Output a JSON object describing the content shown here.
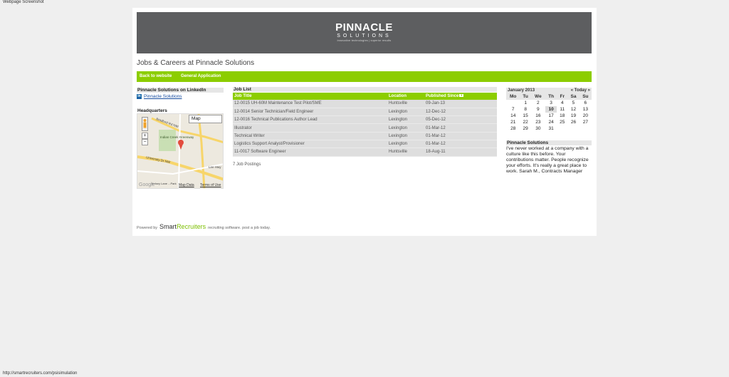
{
  "caption": "Webpage Screenshot",
  "status_url": "http://smartrecruiters.com/psisimulation",
  "banner": {
    "logo_main": "PINNACLE",
    "logo_sub": "SOLUTIONS",
    "logo_tag": "innovative technologies | superior results",
    "bg_color": "#5d5e60"
  },
  "page_title": "Jobs & Careers at Pinnacle Solutions",
  "nav": {
    "back_label": "Back to website",
    "general_label": "General Application",
    "accent_color": "#8ccd00"
  },
  "sidebar": {
    "linkedin_title": "Pinnacle Solutions on LinkedIn",
    "linkedin_link": "Pinnacle Solutions",
    "linkedin_icon": "in",
    "hq_title": "Headquarters",
    "map": {
      "type_select": "Map",
      "zoom_in": "+",
      "zoom_out": "−",
      "label_park": "Indian Creek Greenway",
      "label_road1": "University Dr NW",
      "label_road2": "Lee Hwy",
      "label_road3": "Bradford Rd NW",
      "label_bottom": "Kelsey Lane ...Park",
      "google": "Google",
      "map_data": "Map Data",
      "terms": "Terms of Use"
    }
  },
  "jobs": {
    "section_title": "Job List",
    "columns": [
      "Job Title",
      "Location",
      "Published Since"
    ],
    "rows": [
      {
        "title": "12-0015 UH-60M Maintenance Test Pilot/SME",
        "location": "Huntsville",
        "date": "09-Jan-13"
      },
      {
        "title": "12-0014 Senior Technician/Field Engineer",
        "location": "Lexington",
        "date": "12-Dec-12"
      },
      {
        "title": "12-0016 Technical Publications Author Lead",
        "location": "Lexington",
        "date": "05-Dec-12"
      },
      {
        "title": "Illustrator",
        "location": "Lexington",
        "date": "01-Mar-12"
      },
      {
        "title": "Technical Writer",
        "location": "Lexington",
        "date": "01-Mar-12"
      },
      {
        "title": "Logistics Support Analyst/Provisioner",
        "location": "Lexington",
        "date": "01-Mar-12"
      },
      {
        "title": "11-0017 Software Engineer",
        "location": "Huntsville",
        "date": "18-Aug-11"
      }
    ],
    "count_text": "7 Job Postings"
  },
  "calendar": {
    "month": "January 2013",
    "prev": "«",
    "today_label": "Today",
    "next": "»",
    "days": [
      "Mo",
      "Tu",
      "We",
      "Th",
      "Fr",
      "Sa",
      "Su"
    ],
    "weeks": [
      [
        "",
        "1",
        "2",
        "3",
        "4",
        "5",
        "6"
      ],
      [
        "7",
        "8",
        "9",
        "10",
        "11",
        "12",
        "13"
      ],
      [
        "14",
        "15",
        "16",
        "17",
        "18",
        "19",
        "20"
      ],
      [
        "21",
        "22",
        "23",
        "24",
        "25",
        "26",
        "27"
      ],
      [
        "28",
        "29",
        "30",
        "31",
        "",
        "",
        ""
      ]
    ],
    "today": "10"
  },
  "testimonial": {
    "title": "Pinnacle Solutions",
    "text": "I've never worked at a company with a culture like this before. Your contributions matter. People recognize your efforts. It's really a great place to work. Sarah M., Contracts Manager"
  },
  "footer": {
    "powered_by": "Powered by",
    "brand_a": "Smart",
    "brand_b": "Recruiters",
    "tagline": "recruiting software. post a job today."
  }
}
